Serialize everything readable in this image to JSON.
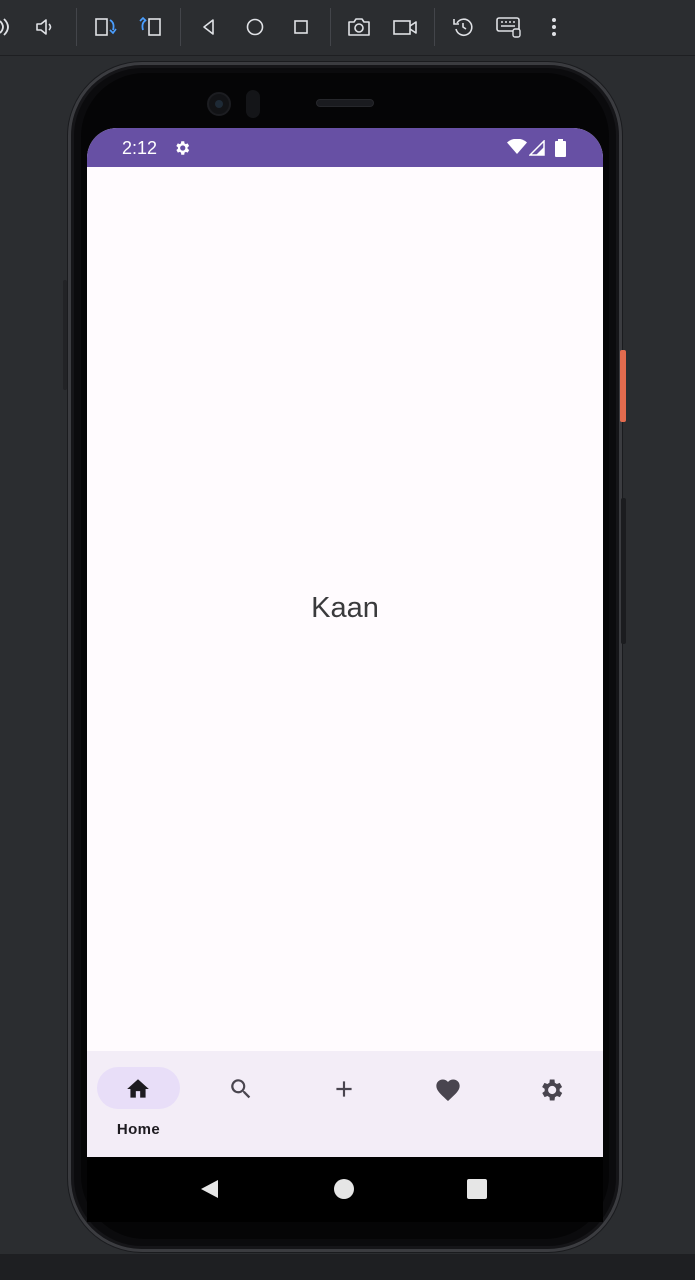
{
  "toolbar": {
    "buttons": [
      {
        "name": "power-icon"
      },
      {
        "name": "volume-icon"
      },
      {
        "name": "rotate-left-icon"
      },
      {
        "name": "rotate-right-icon"
      },
      {
        "name": "back-triangle-icon"
      },
      {
        "name": "home-circle-icon"
      },
      {
        "name": "overview-square-icon"
      },
      {
        "name": "camera-icon"
      },
      {
        "name": "screenrecord-icon"
      },
      {
        "name": "snapshot-restore-icon"
      },
      {
        "name": "keyboard-icon"
      },
      {
        "name": "more-vert-icon"
      }
    ]
  },
  "status_bar": {
    "time": "2:12",
    "background": "#6750a4"
  },
  "main": {
    "text": "Kaan"
  },
  "bottom_nav": {
    "background": "#f3edf7",
    "active_pill": "#e8def8",
    "items": [
      {
        "name": "home",
        "label": "Home",
        "icon": "home-icon",
        "active": true
      },
      {
        "name": "search",
        "label": "",
        "icon": "search-icon",
        "active": false
      },
      {
        "name": "add",
        "label": "",
        "icon": "add-icon",
        "active": false
      },
      {
        "name": "favorites",
        "label": "",
        "icon": "heart-icon",
        "active": false
      },
      {
        "name": "settings",
        "label": "",
        "icon": "gear-icon",
        "active": false
      }
    ]
  },
  "system_nav": {
    "buttons": [
      "back",
      "home",
      "recents"
    ]
  }
}
